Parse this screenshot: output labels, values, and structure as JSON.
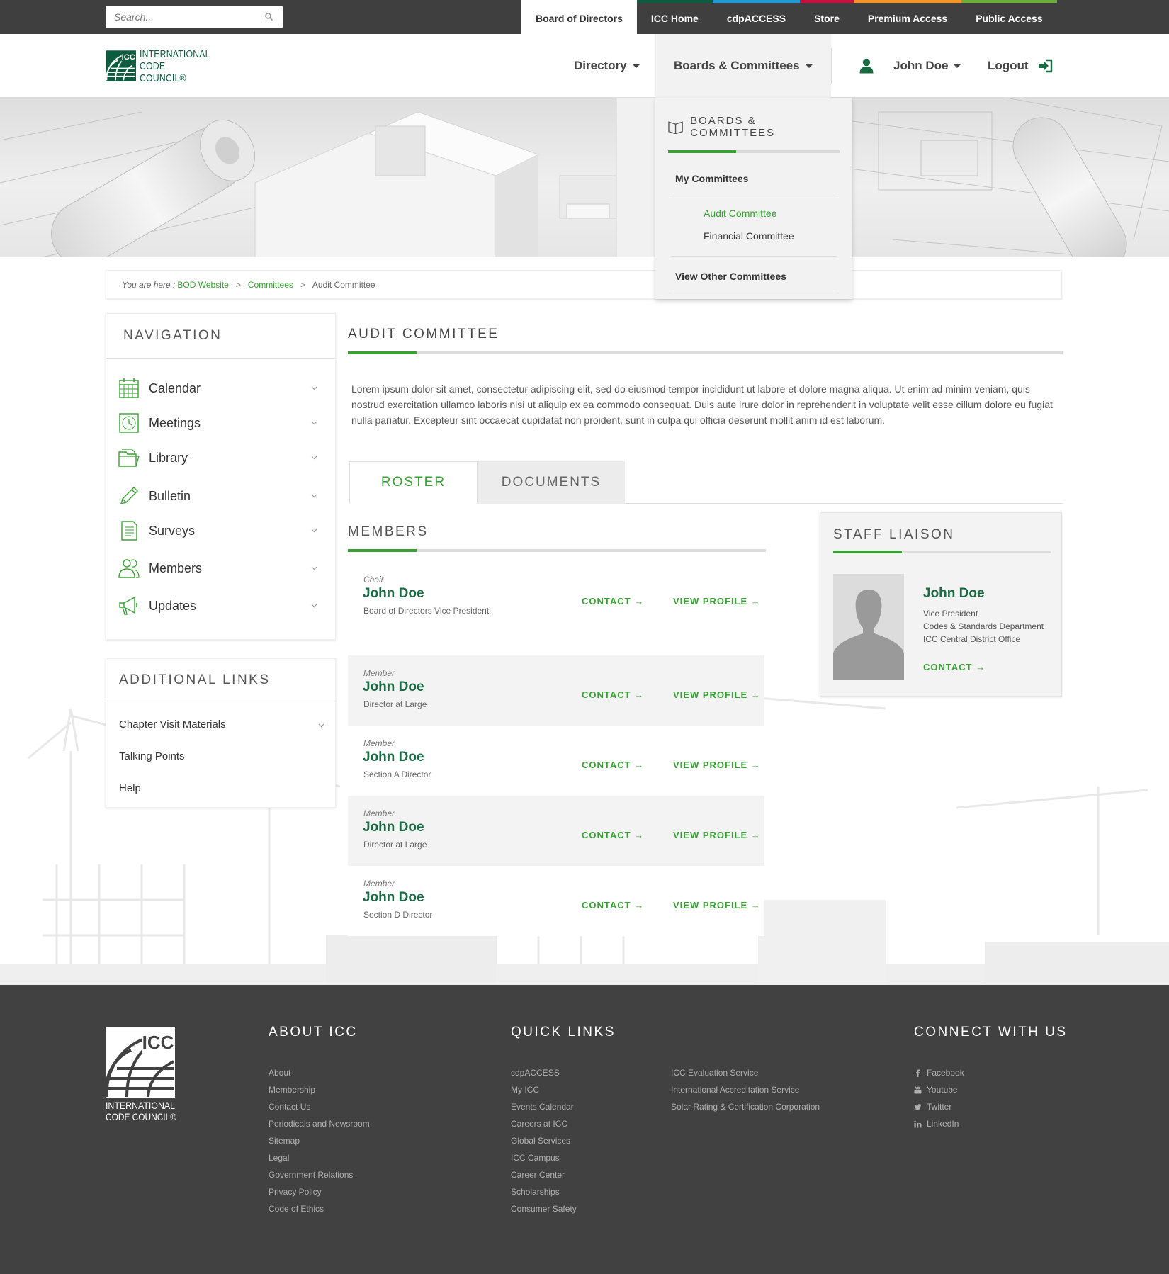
{
  "search": {
    "placeholder": "Search..."
  },
  "top_tabs": [
    {
      "label": "Board of Directors",
      "color": ""
    },
    {
      "label": "ICC Home",
      "color": "#0d5c3f"
    },
    {
      "label": "cdpACCESS",
      "color": "#1e9ad6"
    },
    {
      "label": "Store",
      "color": "#c8103e"
    },
    {
      "label": "Premium Access",
      "color": "#f39324"
    },
    {
      "label": "Public Access",
      "color": "#6aae3b"
    }
  ],
  "logo": {
    "line1": "INTERNATIONAL",
    "line2": "CODE",
    "line3": "COUNCIL®",
    "mark": "ICC"
  },
  "main_nav": {
    "directory": "Directory",
    "boards": "Boards & Committees",
    "user": "John Doe",
    "logout": "Logout"
  },
  "dropdown": {
    "title": "BOARDS & COMMITTEES",
    "my_committees": "My Committees",
    "items": [
      "Audit Committee",
      "Financial Committee"
    ],
    "view_other": "View Other Committees"
  },
  "breadcrumb": {
    "prefix": "You are here :",
    "items": [
      "BOD Website",
      "Committees",
      "Audit Committee"
    ],
    "separator": ">"
  },
  "navigation": {
    "title": "NAVIGATION",
    "items": [
      {
        "label": "Calendar",
        "icon": "calendar-icon"
      },
      {
        "label": "Meetings",
        "icon": "clock-icon"
      },
      {
        "label": "Library",
        "icon": "folder-icon"
      },
      {
        "label": "Bulletin",
        "icon": "pencil-icon"
      },
      {
        "label": "Surveys",
        "icon": "document-icon"
      },
      {
        "label": "Members",
        "icon": "people-icon"
      },
      {
        "label": "Updates",
        "icon": "megaphone-icon"
      }
    ]
  },
  "additional_links": {
    "title": "ADDITIONAL LINKS",
    "items": [
      "Chapter Visit Materials",
      "Talking Points",
      "Help"
    ]
  },
  "page": {
    "title": "AUDIT COMMITTEE",
    "description": "Lorem ipsum dolor sit amet, consectetur adipiscing elit, sed do eiusmod tempor incididunt ut labore et dolore magna aliqua. Ut enim ad minim veniam, quis nostrud exercitation ullamco laboris nisi ut aliquip ex ea commodo consequat. Duis aute irure dolor in reprehenderit in voluptate velit esse cillum dolore eu fugiat nulla pariatur. Excepteur sint occaecat cupidatat non proident, sunt in culpa qui officia deserunt mollit anim id est laborum."
  },
  "tabs": {
    "roster": "ROSTER",
    "documents": "DOCUMENTS"
  },
  "members": {
    "title": "MEMBERS",
    "contact_label": "CONTACT →",
    "profile_label": "VIEW PROFILE →",
    "list": [
      {
        "role": "Chair",
        "name": "John Doe",
        "title": "Board of Directors Vice President"
      },
      {
        "role": "Member",
        "name": "John Doe",
        "title": "Director at Large"
      },
      {
        "role": "Member",
        "name": "John Doe",
        "title": "Section A Director"
      },
      {
        "role": "Member",
        "name": "John Doe",
        "title": "Director at Large"
      },
      {
        "role": "Member",
        "name": "John Doe",
        "title": "Section D Director"
      }
    ]
  },
  "staff_liaison": {
    "title": "STAFF LIAISON",
    "name": "John Doe",
    "lines": [
      "Vice President",
      "Codes & Standards Department",
      "ICC Central District Office"
    ],
    "contact": "CONTACT →"
  },
  "footer": {
    "logo_text": {
      "mark": "ICC",
      "line1": "INTERNATIONAL",
      "line2": "CODE COUNCIL®"
    },
    "about": {
      "title": "ABOUT ICC",
      "links": [
        "About",
        "Membership",
        "Contact Us",
        "Periodicals and Newsroom",
        "Sitemap",
        "Legal",
        "Government Relations",
        "Privacy Policy",
        "Code of Ethics"
      ]
    },
    "quick_links": {
      "title": "QUICK LINKS",
      "col1": [
        "cdpACCESS",
        "My ICC",
        "Events Calendar",
        "Careers at ICC",
        "Global Services",
        "ICC Campus",
        "Career Center",
        "Scholarships",
        "Consumer Safety"
      ],
      "col2": [
        "ICC Evaluation Service",
        "International Accreditation Service",
        "Solar Rating & Certification Corporation"
      ]
    },
    "connect": {
      "title": "CONNECT WITH US",
      "links": [
        {
          "label": "Facebook",
          "icon": "facebook-icon"
        },
        {
          "label": "Youtube",
          "icon": "youtube-icon"
        },
        {
          "label": "Twitter",
          "icon": "twitter-icon"
        },
        {
          "label": "LinkedIn",
          "icon": "linkedin-icon"
        }
      ]
    }
  },
  "colors": {
    "accent": "#3aa035",
    "brand": "#0d5c3f",
    "topbar": "#3f3f3f",
    "footer": "#414141"
  }
}
